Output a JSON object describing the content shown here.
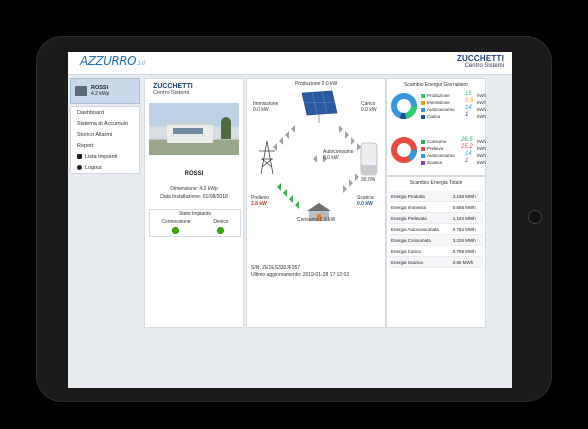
{
  "header": {
    "brand_left": "AZZURRO",
    "brand_left_sub": "3.0",
    "brand_right_title": "ZUCCHETTI",
    "brand_right_sub": "Centro Sistemi"
  },
  "sidebar": {
    "user_name": "ROSSI",
    "user_power": "4.2 kWp",
    "items": [
      {
        "label": "Dashboard",
        "icon": ""
      },
      {
        "label": "Sistema di Accumulo",
        "icon": ""
      },
      {
        "label": "Storico Allarmi",
        "icon": ""
      },
      {
        "label": "Report",
        "icon": ""
      },
      {
        "label": "Lista Impianti",
        "icon": "list-icon"
      },
      {
        "label": "Logout",
        "icon": "logout-icon"
      }
    ]
  },
  "plant": {
    "logo_title": "ZUCCHETTI",
    "logo_sub": "Centro Sistemi",
    "name": "ROSSI",
    "dimension": "Dimensione: 4.2 kWp",
    "install_date": "Data Installazione: 01/08/2018",
    "status_title": "Stato Impianto",
    "status_cols": [
      {
        "label": "Connessione",
        "color": "#38b000"
      },
      {
        "label": "Device",
        "color": "#38b000"
      }
    ]
  },
  "flow": {
    "produzione": "Produzione 0.0 kW",
    "immissione_label": "Immissione",
    "immissione_value": "0.0 kW",
    "carico_label": "Carico",
    "carico_value": "0.0 kW",
    "autoconsumo_label": "Autoconsumo",
    "autoconsumo_value": "0.0 kW",
    "battery_percent": "30.0%",
    "prelievo_label": "Prelievo",
    "prelievo_value": "2.8 kW",
    "scarica_label": "Scarica",
    "scarica_value": "0.0 kW",
    "consumo": "Consumo 2.8 kW",
    "serial": "S/N: ZE1ES330JF357",
    "last_update": "Ultimo aggiornamento: 2019-01-28 17:12:02"
  },
  "scambio_giornaliero": {
    "title": "Scambio Energia Giornaliero",
    "top": [
      {
        "label": "Produzione",
        "value": "15",
        "unit": "kWh",
        "color": "#2ecc71"
      },
      {
        "label": "Immissione",
        "value": "0.5",
        "unit": "kWh",
        "color": "#f39c12"
      },
      {
        "label": "Autoconsumo",
        "value": "14",
        "unit": "kWh",
        "color": "#3498db"
      },
      {
        "label": "Carica",
        "value": "1",
        "unit": "kWh",
        "color": "#1f4e9a"
      }
    ],
    "bottom": [
      {
        "label": "Consumo",
        "value": "26.5",
        "unit": "kWh",
        "color": "#27ae60"
      },
      {
        "label": "Prelievo",
        "value": "25.2",
        "unit": "kWh",
        "color": "#e74c3c"
      },
      {
        "label": "Autoconsumo",
        "value": "14",
        "unit": "kWh",
        "color": "#3498db"
      },
      {
        "label": "Scarica",
        "value": "1",
        "unit": "kWh",
        "color": "#8e44ad"
      }
    ]
  },
  "scambio_totale": {
    "title": "Scambio Energia Totale",
    "rows": [
      {
        "label": "Energia Prodotta",
        "value": "3.188 MWh"
      },
      {
        "label": "Energia Immessa",
        "value": "0.668 MWh"
      },
      {
        "label": "Energia Prelevata",
        "value": "1.183 MWh"
      },
      {
        "label": "Energia Autoconsumata",
        "value": "0.784 MWh"
      },
      {
        "label": "Energia Consumata",
        "value": "3.226 MWh"
      },
      {
        "label": "Energia Carica",
        "value": "0.758 MWh"
      },
      {
        "label": "Energia Scarica",
        "value": "0.65 MWh"
      }
    ]
  }
}
